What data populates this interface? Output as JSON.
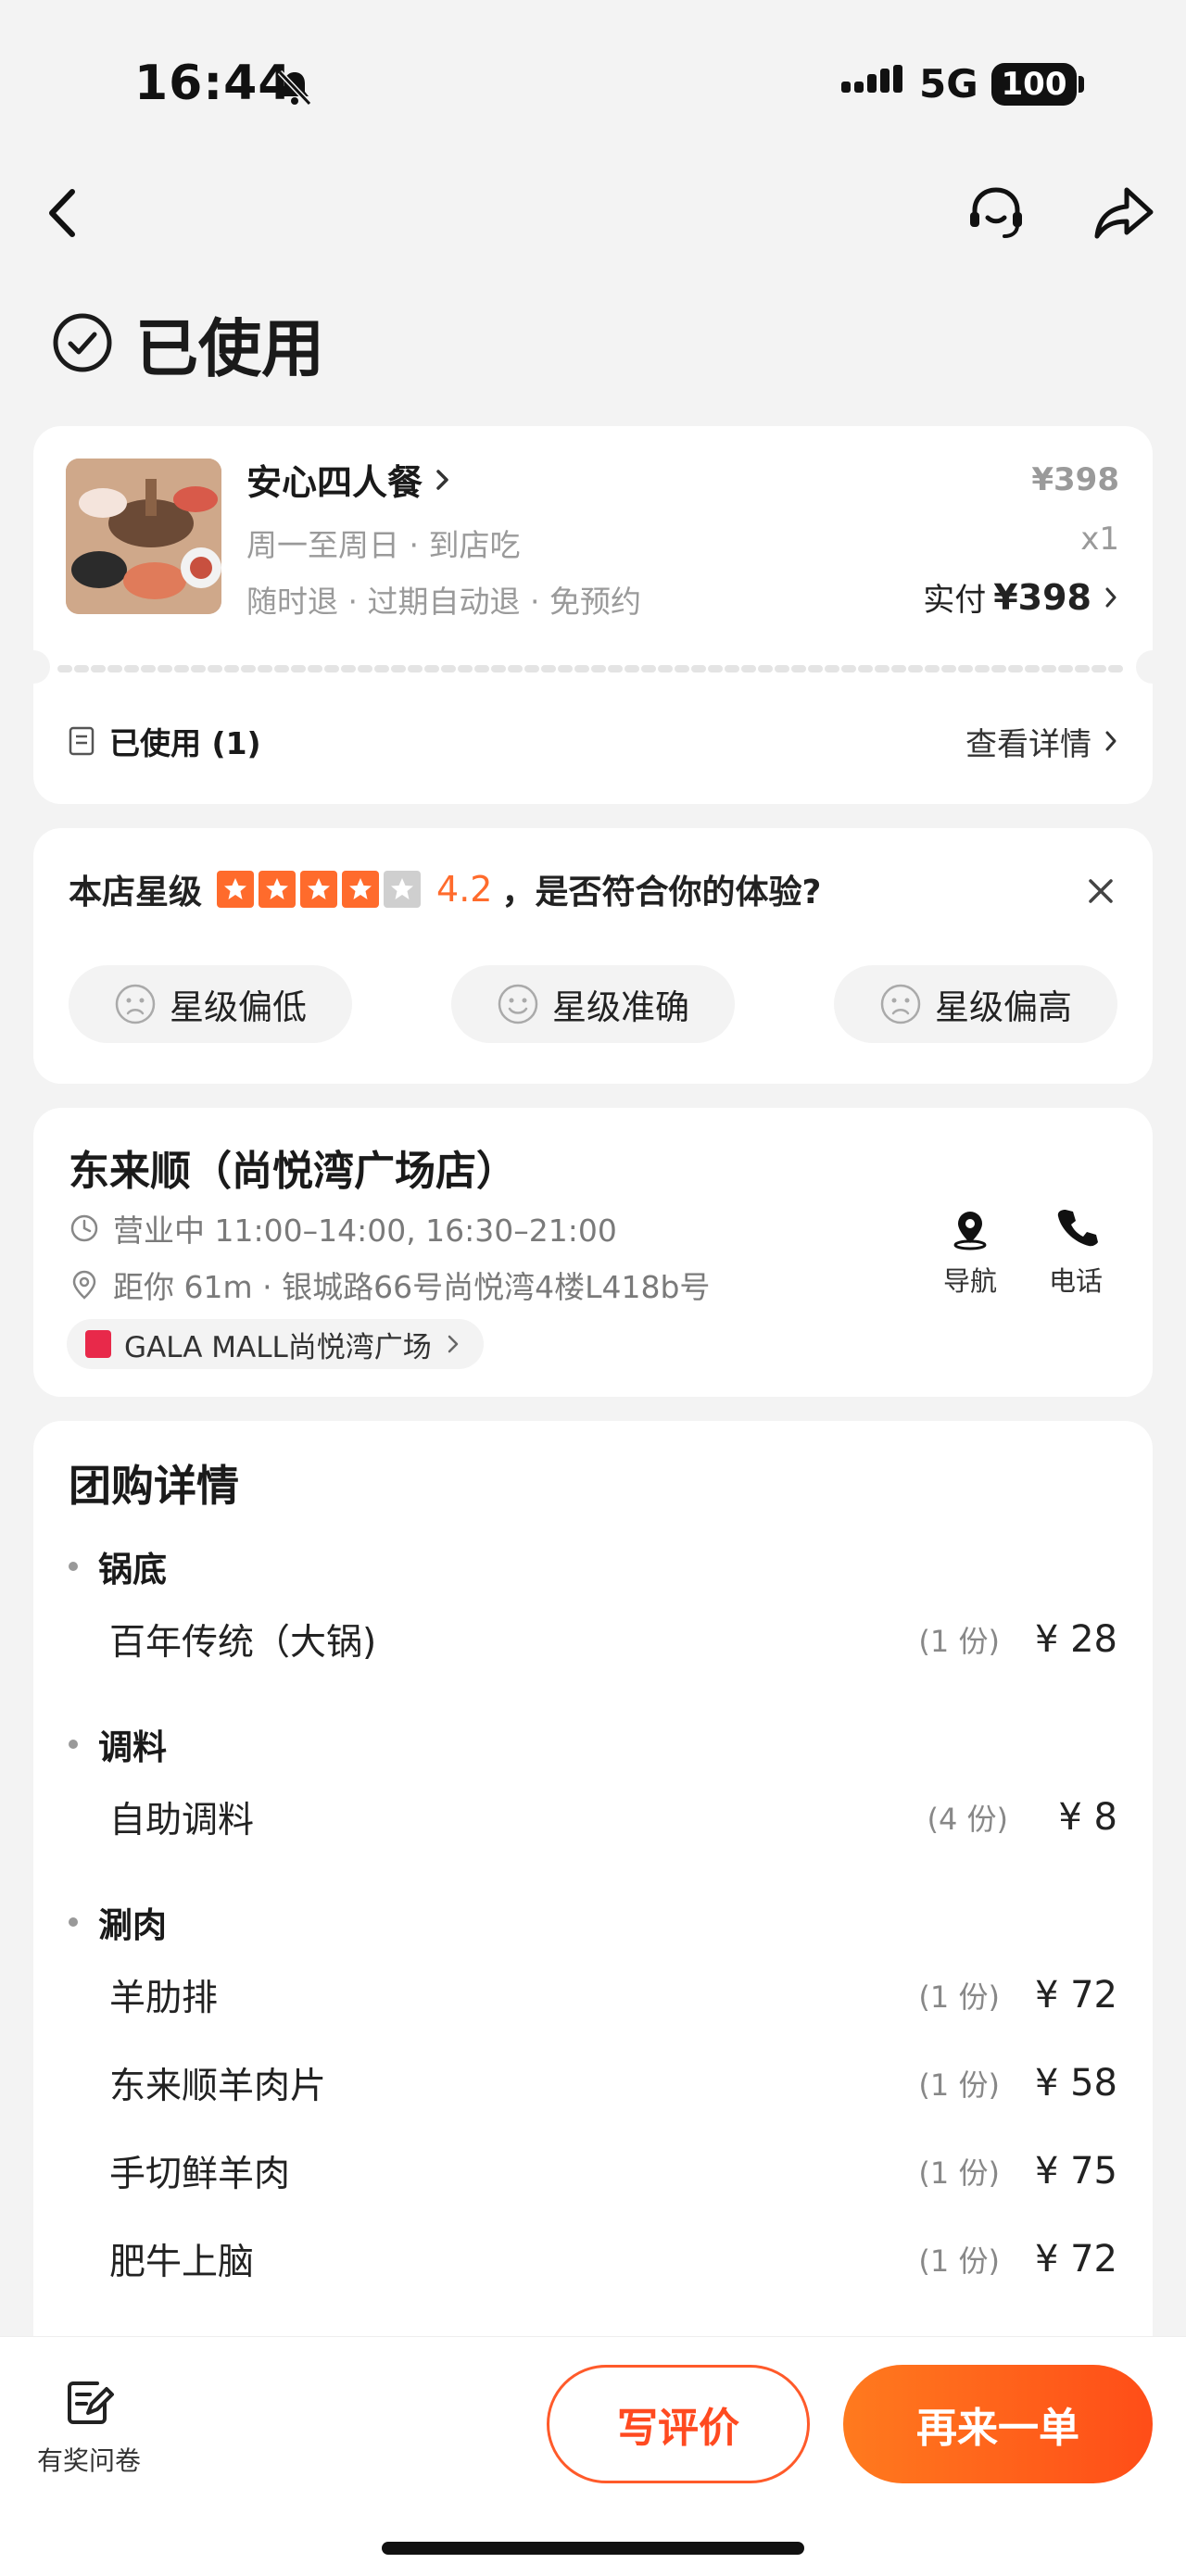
{
  "status_bar": {
    "time": "16:44",
    "network": "5G",
    "battery": "100"
  },
  "header": {
    "status_title": "已使用"
  },
  "order": {
    "name": "安心四人餐",
    "line1": "周一至周日 · 到店吃",
    "line2": "随时退 · 过期自动退 · 免预约",
    "original_price": "¥398",
    "quantity": "x1",
    "paid_label": "实付",
    "paid_amount": "¥398",
    "used_label": "已使用 (1)",
    "detail_link": "查看详情"
  },
  "rating": {
    "label": "本店星级",
    "stars_filled": 4,
    "stars_total": 5,
    "value": "4.2",
    "question": "，是否符合你的体验?",
    "options": [
      "星级偏低",
      "星级准确",
      "星级偏高"
    ]
  },
  "store": {
    "name": "东来顺（尚悦湾广场店）",
    "hours": "营业中 11:00–14:00, 16:30–21:00",
    "address": "距你 61m ·  银城路66号尚悦湾4楼L418b号",
    "mall": "GALA MALL尚悦湾广场",
    "nav_label": "导航",
    "call_label": "电话"
  },
  "deal": {
    "title": "团购详情",
    "sections": [
      {
        "name": "锅底",
        "items": [
          {
            "name": "百年传统（大锅)",
            "qty": "(1 份)",
            "price": "¥ 28"
          }
        ]
      },
      {
        "name": "调料",
        "items": [
          {
            "name": "自助调料",
            "qty": "(4 份)",
            "price": "¥ 8"
          }
        ]
      },
      {
        "name": "涮肉",
        "items": [
          {
            "name": "羊肋排",
            "qty": "(1 份)",
            "price": "¥ 72"
          },
          {
            "name": "东来顺羊肉片",
            "qty": "(1 份)",
            "price": "¥ 58"
          },
          {
            "name": "手切鲜羊肉",
            "qty": "(1 份)",
            "price": "¥ 75"
          },
          {
            "name": "肥牛上脑",
            "qty": "(1 份)",
            "price": "¥ 72"
          }
        ]
      }
    ]
  },
  "bottom_bar": {
    "survey_label": "有奖问卷",
    "review_button": "写评价",
    "reorder_button": "再来一单"
  }
}
